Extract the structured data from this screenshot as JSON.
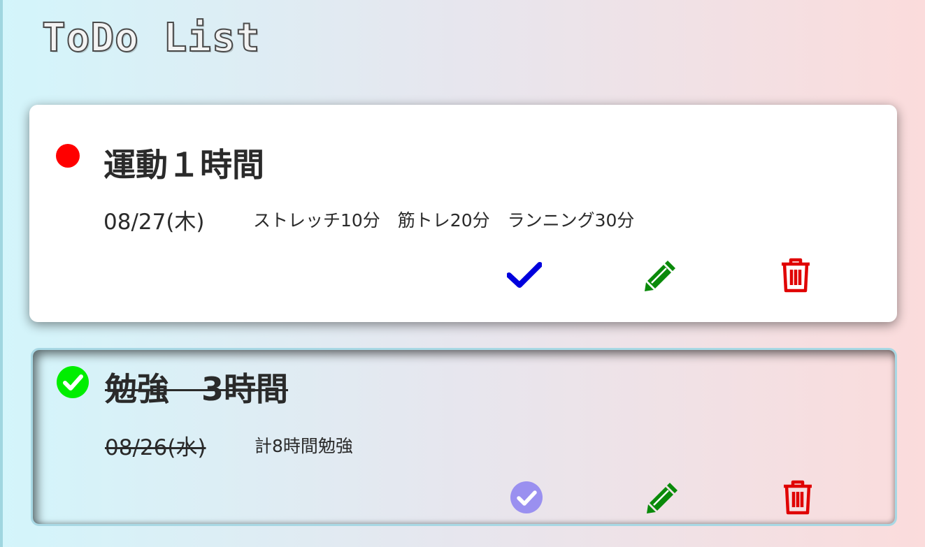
{
  "app": {
    "title": "ToDo List"
  },
  "todos": [
    {
      "title": "運動１時間",
      "date": "08/27(木)",
      "note": "ストレッチ10分　筋トレ20分　ランニング30分",
      "status": "pending",
      "status_color": "#ff0000"
    },
    {
      "title": "勉強　3時間",
      "date": "08/26(水)",
      "note": "計8時間勉強",
      "status": "completed",
      "status_color": "#00ee00"
    }
  ],
  "actions": {
    "complete_icon": "check-icon",
    "completed_icon": "check-circle-icon",
    "edit_icon": "pencil-icon",
    "delete_icon": "trash-icon"
  },
  "colors": {
    "complete": "#0000dd",
    "completed_disabled": "#9a90f0",
    "edit": "#0a8a0a",
    "delete": "#e00000"
  }
}
